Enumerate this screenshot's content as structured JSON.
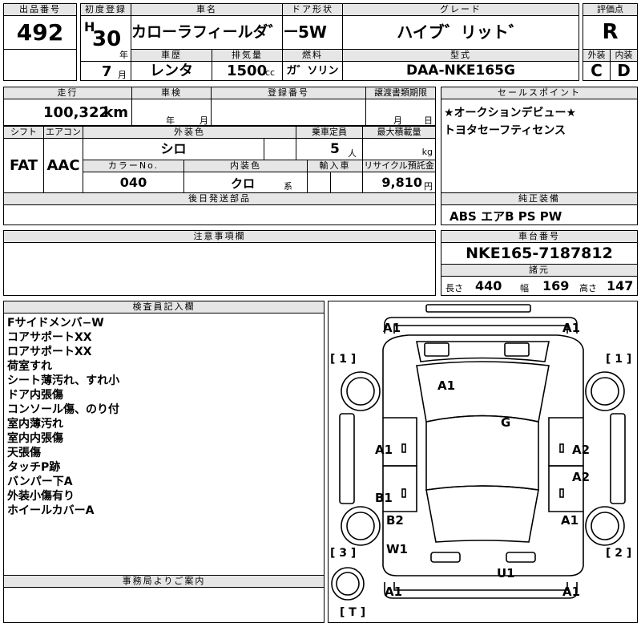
{
  "header": {
    "lot_label": "出品番号",
    "lot": "492",
    "first_reg_label": "初度登録",
    "era": "H",
    "year_num": "30",
    "year_unit": "年",
    "month_num": "7",
    "month_unit": "月",
    "car_name_label": "車名",
    "car_name": "カローラフィールダ゛ー",
    "door_label": "ドア形状",
    "door": "5W",
    "grade_label": "グレード",
    "grade": "ハイブ゛リット゛",
    "score_label": "評価点",
    "score": "R",
    "history_label": "車歴",
    "history": "レンタ",
    "displacement_label": "排気量",
    "displacement": "1500",
    "displacement_unit": "cc",
    "fuel_label": "燃料",
    "fuel": "ガ゛ソリン",
    "model_label": "型式",
    "model": "DAA-NKE165G",
    "ext_label": "外装",
    "ext_grade": "C",
    "int_label": "内装",
    "int_grade": "D"
  },
  "row2": {
    "mileage_label": "走行",
    "mileage": "100,322",
    "mileage_unit": "km",
    "inspection_label": "車検",
    "inspection_year": "年",
    "inspection_month": "月",
    "reg_label": "登録番号",
    "transfer_label": "譲渡書類期限",
    "transfer_month": "月",
    "transfer_day": "日",
    "shift_label": "シフト",
    "shift": "FAT",
    "ac_label": "エアコン",
    "ac": "AAC",
    "ext_color_label": "外装色",
    "ext_color": "シロ",
    "capacity_label": "乗車定員",
    "capacity": "5",
    "capacity_unit": "人",
    "load_label": "最大積載量",
    "load_unit": "kg",
    "color_no_label": "カラーNo.",
    "color_no": "040",
    "int_color_label": "内装色",
    "int_color": "クロ",
    "int_color_unit": "系",
    "import_label": "輸入車",
    "recycle_label": "リサイクル預託金",
    "recycle": "9,810",
    "recycle_unit": "円"
  },
  "selling_points": {
    "label": "セールスポイント",
    "lines": [
      "★オークションデビュー★",
      "トヨタセーフティセンス"
    ]
  },
  "later_parts": {
    "label": "後日発送部品"
  },
  "genuine_equipment": {
    "label": "純正装備",
    "value": "ABS エアB PS PW"
  },
  "caution": {
    "label": "注意事項欄"
  },
  "chassis": {
    "label": "車台番号",
    "value": "NKE165-7187812"
  },
  "specs": {
    "label": "諸元",
    "length_label": "長さ",
    "length": "440",
    "width_label": "幅",
    "width": "169",
    "height_label": "高さ",
    "height": "147"
  },
  "inspector": {
    "label": "検査員記入欄",
    "lines": [
      "Fサイドメンバ−W",
      "コアサポートXX",
      "ロアサポートXX",
      "荷室すれ",
      "シート薄汚れ、すれ小",
      "ドア内張傷",
      "コンソール傷、のり付",
      "室内薄汚れ",
      "室内内張傷",
      "天張傷",
      "タッチP跡",
      "バンパー下A",
      "外装小傷有り",
      "ホイールカバーA"
    ]
  },
  "office": {
    "label": "事務局よりご案内"
  },
  "diagram": {
    "marks": [
      "A1",
      "A1",
      "A1",
      "G",
      "A1",
      "A2",
      "A2",
      "B1",
      "B2",
      "A1",
      "W1",
      "U1",
      "A1",
      "A1"
    ],
    "corner_tl": "[ 1 ]",
    "corner_tr": "[ 1 ]",
    "corner_bl": "[ 3 ]",
    "corner_br": "[ 2 ]",
    "corner_t": "[ T ]"
  }
}
